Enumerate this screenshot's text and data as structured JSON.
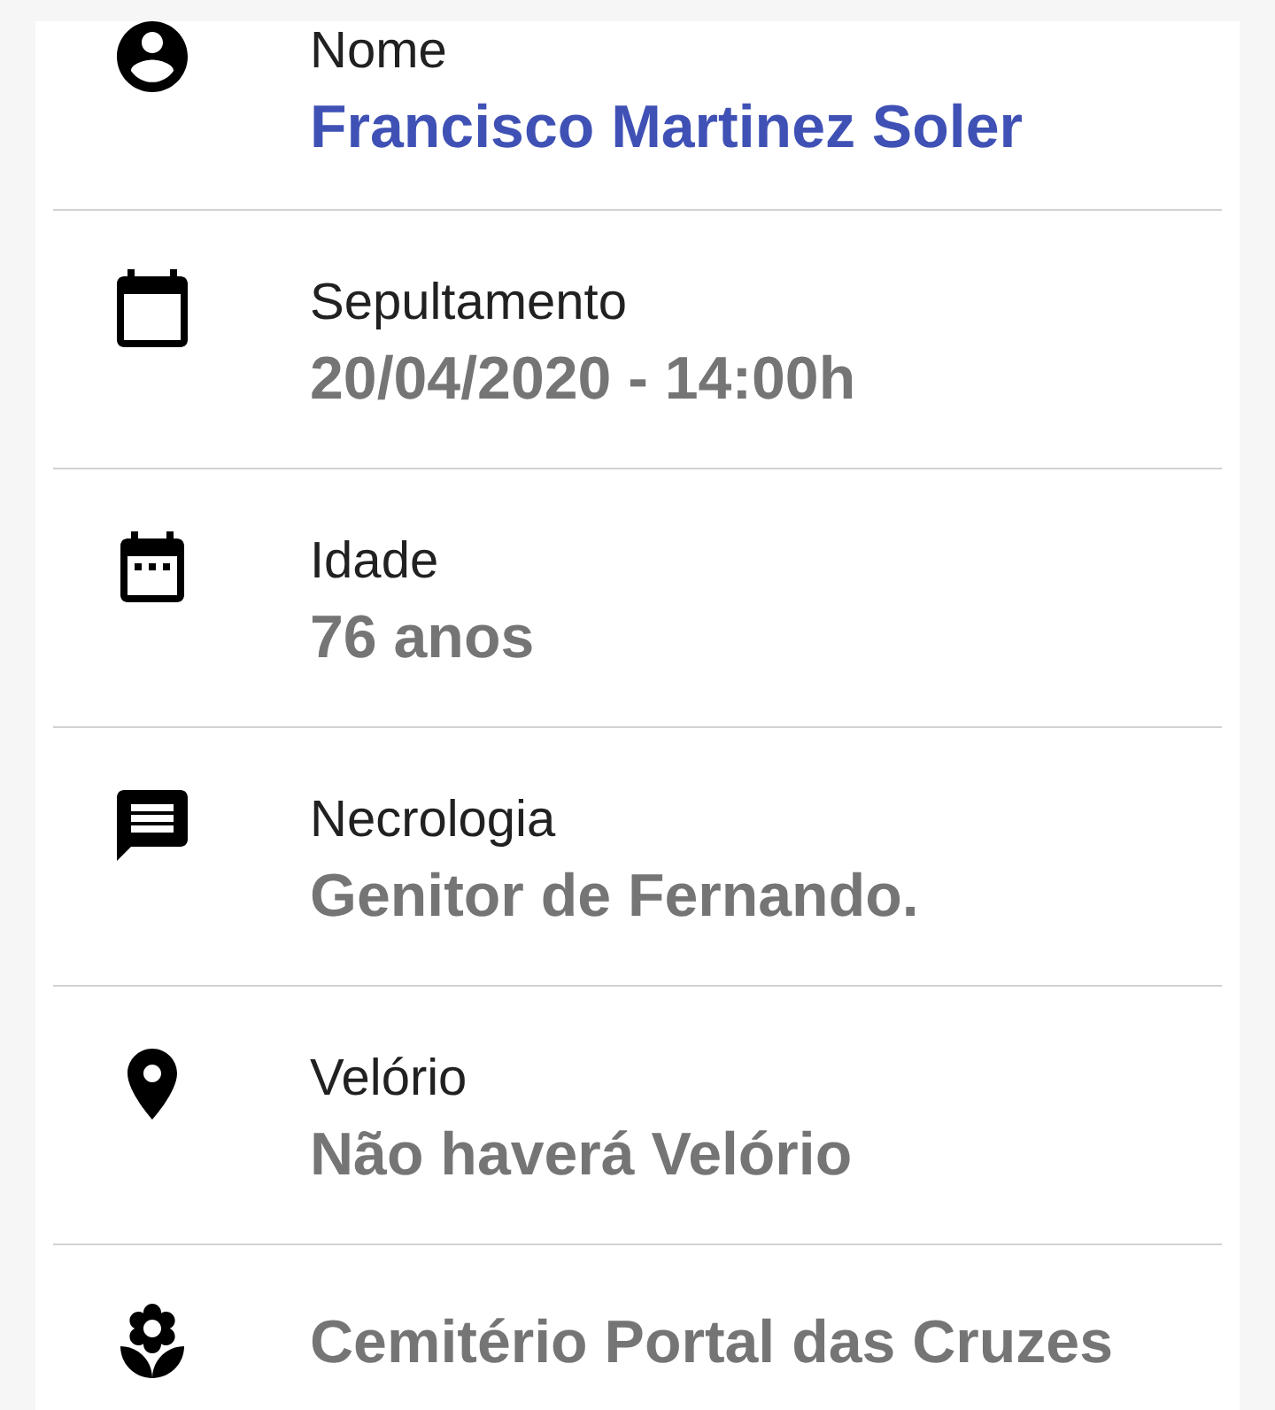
{
  "fields": [
    {
      "kind": "person",
      "label": "Nome",
      "value": "Francisco Martinez Soler",
      "highlighted": true
    },
    {
      "kind": "calendar",
      "label": "Sepultamento",
      "value": "20/04/2020 - 14:00h",
      "highlighted": false
    },
    {
      "kind": "agenda",
      "label": "Idade",
      "value": "76 anos",
      "highlighted": false
    },
    {
      "kind": "message",
      "label": "Necrologia",
      "value": "Genitor de Fernando.",
      "highlighted": false
    },
    {
      "kind": "pin",
      "label": "Velório",
      "value": "Não haverá Velório",
      "highlighted": false
    },
    {
      "kind": "flower",
      "value": "Cemitério Portal das Cruzes",
      "highlighted": false
    }
  ]
}
